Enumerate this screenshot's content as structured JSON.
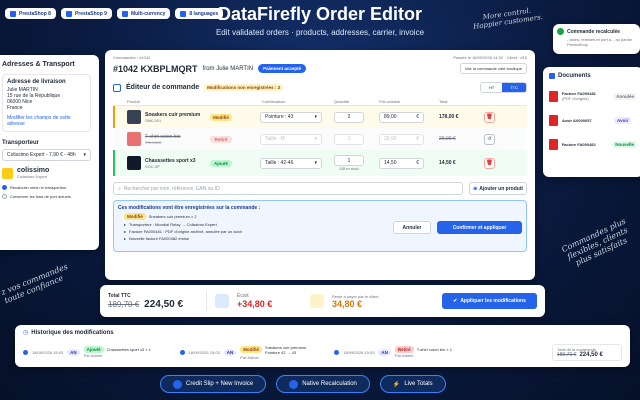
{
  "tags": [
    "PrestaShop 8",
    "PrestaShop 9",
    "Multi-currency",
    "8 languages"
  ],
  "hero": {
    "title": "DataFirefly Order Editor",
    "subtitle": "Edit validated orders · products, addresses, carrier, invoice"
  },
  "hand": {
    "top": "More control. Happier customers.",
    "right": "Commandes plus flexibles, clients plus satisfaits",
    "left": "z vos commandes toute confiance"
  },
  "toast": {
    "title": "Commande recalculée",
    "text": "- taxes, remises et port a... au panier PrestaShop"
  },
  "left": {
    "title": "Adresses & Transport",
    "addr_title": "Adresse de livraison",
    "addr_lines": [
      "Julie MARTIN",
      "15 rue de la République",
      "06000 Nice",
      "France"
    ],
    "edit_link": "Modifier les champs de cette adresse",
    "carrier_title": "Transporteur",
    "carrier_value": "Colissimo Expert - 7,90 € - 48h",
    "carrier_name": "colissimo",
    "carrier_sub": "Colissimo Expert",
    "opt1": "Recalculer selon le transporteur",
    "opt2": "Conserver les frais de port actuels"
  },
  "main": {
    "crumb": "Commandes › #1042",
    "meta": "Passée le 18/09/2026 14:32 · Client : #15",
    "order": "#1042 KXBPLMQRT",
    "from": "from Julie MARTIN",
    "status": "Paiement accepté",
    "view_link": "Voir la commande côté boutique",
    "editor_title": "Éditeur de commande",
    "mod_badge": "Modifications non enregistrées : 3",
    "ht": "HT",
    "ttc": "TTC",
    "cols": [
      "Produit",
      "Combinaison",
      "Quantité",
      "Prix unitaire",
      "Total"
    ],
    "rows": [
      {
        "name": "Sneakers cuir premium",
        "ref": "SNK-001",
        "badge": "Modifié",
        "comb": "Pointure : 43",
        "qty": "2",
        "price": "89,00",
        "total": "178,00 €",
        "note": ""
      },
      {
        "name": "T-shirt coton bio",
        "ref": "TSH-BIO",
        "badge": "Retiré",
        "comb": "Taille : M",
        "qty": "1",
        "price": "29,90",
        "total": "29,90 €",
        "note": ""
      },
      {
        "name": "Chaussettes sport x3",
        "ref": "SOC-3P",
        "badge": "Ajouté",
        "comb": "Taille : 42-46",
        "qty": "1",
        "price": "14,50",
        "total": "14,50 €",
        "note": "248 en stock"
      }
    ],
    "search_ph": "Rechercher par nom, référence, EAN ou ID",
    "add_btn": "Ajouter un produit",
    "summary_title": "Ces modifications vont être enregistrées sur la commande :",
    "summary": [
      {
        "tag": "Modifié",
        "text": "Sneakers cuir premium × 2"
      },
      {
        "tag": "",
        "text": "Transporteur : Mondial Relay → Colissimo Expert"
      },
      {
        "tag": "",
        "text": "Facture FA000481 : PDF d'origine archivé, annulée par un avoir"
      },
      {
        "tag": "",
        "text": "Nouvelle facture FA000482 émise"
      }
    ],
    "cancel": "Annuler",
    "confirm": "Confirmer et appliquer"
  },
  "totals": {
    "label": "Total TTC",
    "old": "189,70 €",
    "new": "224,50 €",
    "ecart_label": "Écart",
    "ecart": "+34,80 €",
    "rest_label": "Reste à payer par le client",
    "rest": "34,80 €",
    "apply": "Appliquer les modifications"
  },
  "docs": {
    "title": "Documents",
    "items": [
      {
        "name": "Facture FA000481",
        "sub": "(PDF d'origine)",
        "badge": "Annulée"
      },
      {
        "name": "Avoir AV000057",
        "sub": "",
        "badge": "Avoir"
      },
      {
        "name": "Facture FA000482",
        "sub": "",
        "badge": "Nouvelle"
      }
    ]
  },
  "history": {
    "title": "Historique des modifications",
    "events": [
      {
        "date": "18/09/2026 15:03",
        "av": "AN",
        "tag": "Ajouté",
        "text": "Chaussettes sport x3 × 1",
        "by": "Par Admin"
      },
      {
        "date": "18/09/2026 15:03",
        "av": "AN",
        "tag": "Modifié",
        "text": "Sneakers cuir premium",
        "text2": "Pointure 42 → 43",
        "by": "Par Admin"
      },
      {
        "date": "18/09/2026 15:03",
        "av": "AN",
        "tag": "Retiré",
        "text": "T-shirt coton bio × 1",
        "by": "Par Admin"
      }
    ],
    "total_label": "Total de la commande",
    "total_old": "189,70 €",
    "total_new": "224,50 €"
  },
  "features": [
    "Credit Slip + New Invoice",
    "Native Recalculation",
    "Live Totals"
  ],
  "colors": {
    "accent": "#2563eb",
    "modified": "#fde68a",
    "removed": "#fecaca",
    "added": "#bbf7d0"
  }
}
